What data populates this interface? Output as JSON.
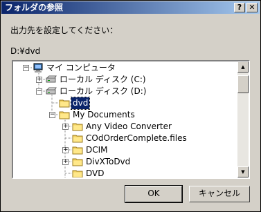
{
  "window": {
    "title": "フォルダの参照",
    "help_label": "?",
    "close_label": "✕"
  },
  "prompt": "出力先を設定してください：",
  "path": "D:¥dvd",
  "tree": [
    {
      "label": "マイ コンピュータ",
      "icon": "computer-icon",
      "expander": "minus"
    },
    {
      "label": "ローカル ディスク (C:)",
      "icon": "drive-icon",
      "expander": "plus"
    },
    {
      "label": "ローカル ディスク (D:)",
      "icon": "drive-icon",
      "expander": "minus"
    },
    {
      "label": "dvd",
      "icon": "folder-icon",
      "expander": "none",
      "selected": true
    },
    {
      "label": "My Documents",
      "icon": "folder-icon",
      "expander": "minus"
    },
    {
      "label": "Any Video Converter",
      "icon": "folder-icon",
      "expander": "plus"
    },
    {
      "label": "COdOrderComplete.files",
      "icon": "folder-icon",
      "expander": "none"
    },
    {
      "label": "DCIM",
      "icon": "folder-icon",
      "expander": "plus"
    },
    {
      "label": "DivXToDvd",
      "icon": "folder-icon",
      "expander": "plus"
    },
    {
      "label": "DVD",
      "icon": "folder-icon",
      "expander": "none"
    },
    {
      "label": "",
      "icon": "folder-icon",
      "expander": "plus"
    }
  ],
  "buttons": {
    "ok": "OK",
    "cancel": "キャンセル"
  },
  "colors": {
    "title_start": "#0a246a",
    "title_end": "#a6caf0",
    "selection": "#0a246a",
    "face": "#d4d0c8"
  }
}
